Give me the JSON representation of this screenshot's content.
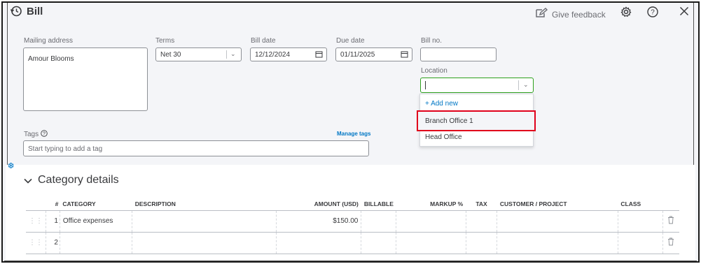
{
  "header": {
    "title": "Bill",
    "feedback_label": "Give feedback"
  },
  "form": {
    "mailing_address": {
      "label": "Mailing address",
      "value": "Amour Blooms"
    },
    "terms": {
      "label": "Terms",
      "value": "Net 30"
    },
    "bill_date": {
      "label": "Bill date",
      "value": "12/12/2024"
    },
    "due_date": {
      "label": "Due date",
      "value": "01/11/2025"
    },
    "bill_no": {
      "label": "Bill no.",
      "value": ""
    },
    "location": {
      "label": "Location",
      "value": ""
    },
    "tags": {
      "label": "Tags",
      "manage_label": "Manage tags",
      "placeholder": "Start typing to add a tag"
    }
  },
  "location_dropdown": {
    "add_new": "+ Add new",
    "options": [
      "Branch Office 1",
      "Head Office"
    ]
  },
  "category_section": {
    "title": "Category details",
    "columns": [
      "#",
      "CATEGORY",
      "DESCRIPTION",
      "AMOUNT (USD)",
      "BILLABLE",
      "MARKUP %",
      "TAX",
      "CUSTOMER / PROJECT",
      "CLASS"
    ],
    "rows": [
      {
        "num": "1",
        "category": "Office expenses",
        "description": "",
        "amount": "$150.00"
      },
      {
        "num": "2",
        "category": "",
        "description": "",
        "amount": ""
      }
    ]
  },
  "colors": {
    "highlight_border": "#e0001b",
    "link": "#0077c5",
    "focus_border": "#2ca01c"
  }
}
